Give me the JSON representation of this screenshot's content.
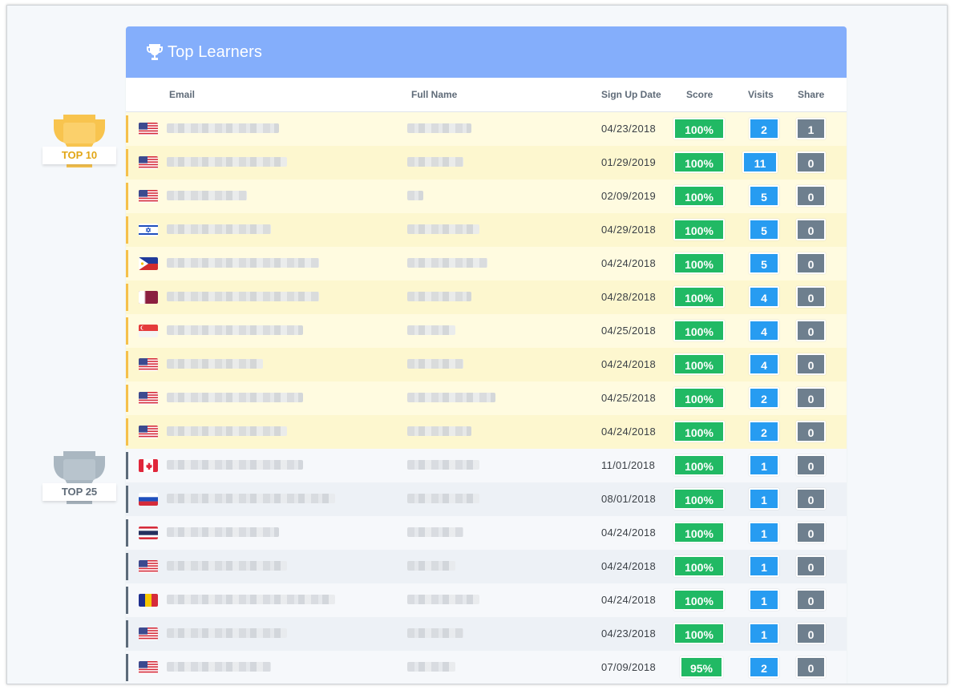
{
  "card": {
    "title": "Top Learners"
  },
  "columns": {
    "email": "Email",
    "full_name": "Full Name",
    "signup": "Sign Up Date",
    "score": "Score",
    "visits": "Visits",
    "share": "Share"
  },
  "tiers": {
    "top10": "TOP 10",
    "top25": "TOP 25"
  },
  "colors": {
    "header": "#84aefb",
    "score": "#21b964",
    "visits": "#279cf1",
    "share": "#6e7f8e",
    "gold": "#f5c04a",
    "silver": "#aab7c1"
  },
  "rows": [
    {
      "flag": "us",
      "tier": "gold",
      "date": "04/23/2018",
      "score": "100%",
      "visits": "2",
      "share": "1"
    },
    {
      "flag": "us",
      "tier": "gold",
      "date": "01/29/2019",
      "score": "100%",
      "visits": "11",
      "share": "0"
    },
    {
      "flag": "us",
      "tier": "gold",
      "date": "02/09/2019",
      "score": "100%",
      "visits": "5",
      "share": "0"
    },
    {
      "flag": "il",
      "tier": "gold",
      "date": "04/29/2018",
      "score": "100%",
      "visits": "5",
      "share": "0"
    },
    {
      "flag": "ph",
      "tier": "gold",
      "date": "04/24/2018",
      "score": "100%",
      "visits": "5",
      "share": "0"
    },
    {
      "flag": "qa",
      "tier": "gold",
      "date": "04/28/2018",
      "score": "100%",
      "visits": "4",
      "share": "0"
    },
    {
      "flag": "sg",
      "tier": "gold",
      "date": "04/25/2018",
      "score": "100%",
      "visits": "4",
      "share": "0"
    },
    {
      "flag": "us",
      "tier": "gold",
      "date": "04/24/2018",
      "score": "100%",
      "visits": "4",
      "share": "0"
    },
    {
      "flag": "us",
      "tier": "gold",
      "date": "04/25/2018",
      "score": "100%",
      "visits": "2",
      "share": "0"
    },
    {
      "flag": "us",
      "tier": "gold",
      "date": "04/24/2018",
      "score": "100%",
      "visits": "2",
      "share": "0"
    },
    {
      "flag": "ca",
      "tier": "blue",
      "date": "11/01/2018",
      "score": "100%",
      "visits": "1",
      "share": "0"
    },
    {
      "flag": "ru",
      "tier": "blue",
      "date": "08/01/2018",
      "score": "100%",
      "visits": "1",
      "share": "0"
    },
    {
      "flag": "th",
      "tier": "blue",
      "date": "04/24/2018",
      "score": "100%",
      "visits": "1",
      "share": "0"
    },
    {
      "flag": "us",
      "tier": "blue",
      "date": "04/24/2018",
      "score": "100%",
      "visits": "1",
      "share": "0"
    },
    {
      "flag": "td",
      "tier": "blue",
      "date": "04/24/2018",
      "score": "100%",
      "visits": "1",
      "share": "0"
    },
    {
      "flag": "us",
      "tier": "blue",
      "date": "04/23/2018",
      "score": "100%",
      "visits": "1",
      "share": "0"
    },
    {
      "flag": "us",
      "tier": "blue",
      "date": "07/09/2018",
      "score": "95%",
      "visits": "2",
      "share": "0"
    }
  ]
}
